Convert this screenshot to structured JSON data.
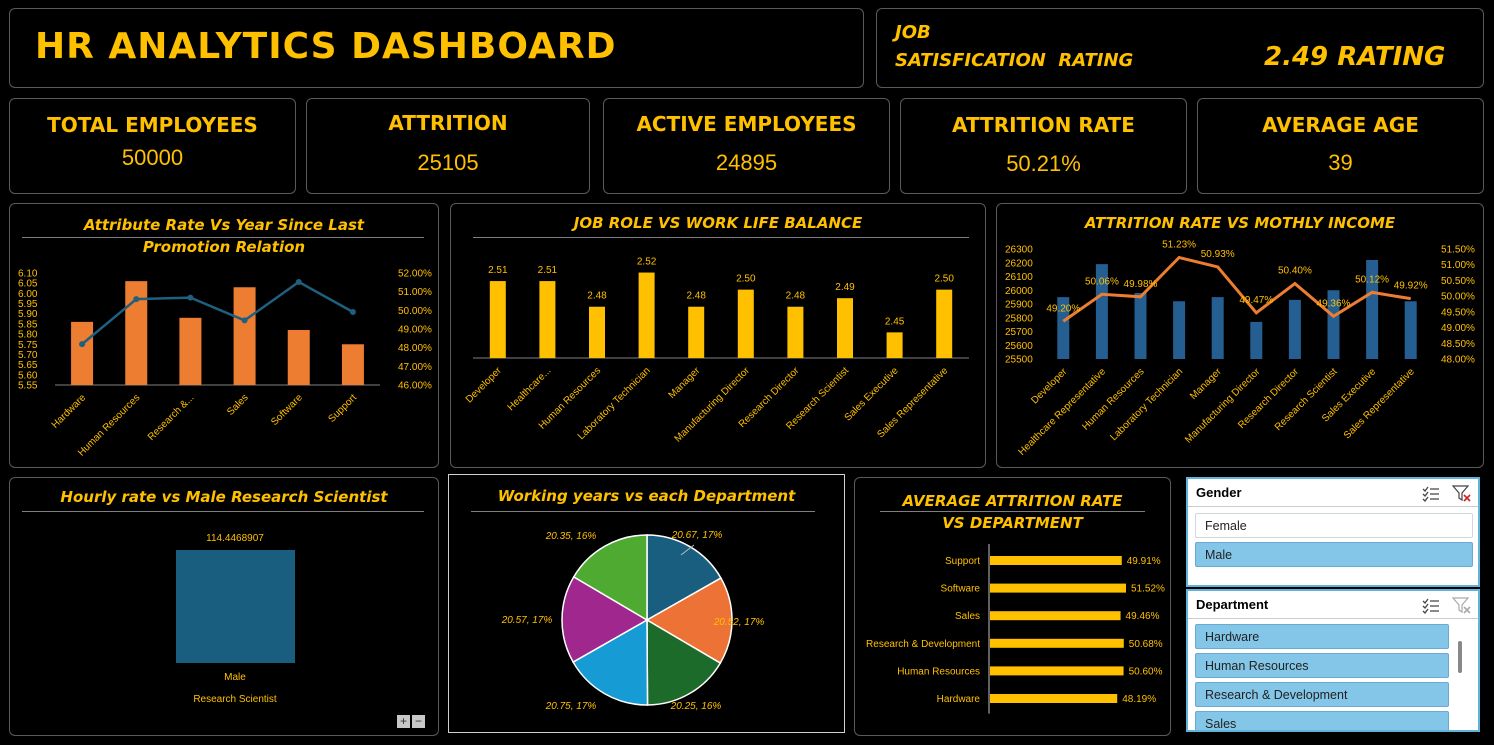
{
  "header": {
    "title": "HR ANALYTICS DASHBOARD"
  },
  "satisfaction": {
    "label_line1": "JOB",
    "label_line2": "SATISFICATION  RATING",
    "value": "2.49 RATING"
  },
  "kpis": [
    {
      "label": "TOTAL EMPLOYEES",
      "value": "50000"
    },
    {
      "label": "ATTRITION",
      "value": "25105"
    },
    {
      "label": "ACTIVE EMPLOYEES",
      "value": "24895"
    },
    {
      "label": "ATTRITION RATE",
      "value": "50.21%"
    },
    {
      "label": "AVERAGE AGE",
      "value": "39"
    }
  ],
  "colors": {
    "accent": "#FFC000",
    "bar_orange": "#ED7D31",
    "bar_blue": "#255E91",
    "line_blue": "#1F5F7F",
    "slicer_selected": "#84C6E8"
  },
  "chart_data": [
    {
      "type": "bar",
      "title": "Attribute Rate Vs Year Since Last Promotion Relation",
      "categories": [
        "Hardware",
        "Human Resources",
        "Research &...",
        "Sales",
        "Software",
        "Support"
      ],
      "series": [
        {
          "values": [
            5.86,
            6.06,
            5.88,
            6.03,
            5.82,
            5.75
          ]
        },
        {
          "values": [
            48.19,
            50.6,
            50.68,
            49.46,
            51.52,
            49.91
          ]
        }
      ],
      "ylim": [
        5.55,
        6.1
      ],
      "y_ticks": [
        "6.10",
        "6.05",
        "6.00",
        "5.95",
        "5.90",
        "5.85",
        "5.80",
        "5.75",
        "5.70",
        "5.65",
        "5.60",
        "5.55"
      ],
      "y2lim": [
        46,
        52
      ],
      "y2_ticks": [
        "52.00%",
        "51.00%",
        "50.00%",
        "49.00%",
        "48.00%",
        "47.00%",
        "46.00%"
      ]
    },
    {
      "type": "bar",
      "title": "JOB ROLE VS WORK LIFE BALANCE",
      "categories": [
        "Developer",
        "Healthcare...",
        "Human Resources",
        "Laboratory Technician",
        "Manager",
        "Manufacturing Director",
        "Research Director",
        "Research Scientist",
        "Sales Executive",
        "Sales Representative"
      ],
      "values": [
        2.51,
        2.51,
        2.48,
        2.52,
        2.48,
        2.5,
        2.48,
        2.49,
        2.45,
        2.5
      ],
      "labels": [
        "2.51",
        "2.51",
        "2.48",
        "2.52",
        "2.48",
        "2.50",
        "2.48",
        "2.49",
        "2.45",
        "2.50"
      ],
      "ylim": [
        2.42,
        2.53
      ]
    },
    {
      "type": "bar",
      "title": "ATTRITION RATE VS MOTHLY INCOME",
      "categories": [
        "Developer",
        "Healthcare Representative",
        "Human Resources",
        "Laboratory Technician",
        "Manager",
        "Manufacturing Director",
        "Research Director",
        "Research Scientist",
        "Sales Executive",
        "Sales Representative"
      ],
      "series": [
        {
          "values": [
            25950,
            26190,
            25980,
            25920,
            25950,
            25770,
            25930,
            26000,
            26220,
            25920
          ]
        },
        {
          "values": [
            49.2,
            50.06,
            49.98,
            51.23,
            50.93,
            49.47,
            50.4,
            49.36,
            50.12,
            49.92
          ]
        }
      ],
      "line_labels": [
        "49.20%",
        "50.06%",
        "49.98%",
        "51.23%",
        "50.93%",
        "49.47%",
        "50.40%",
        "49.36%",
        "50.12%",
        "49.92%"
      ],
      "ylim": [
        25500,
        26300
      ],
      "y_ticks": [
        "26300",
        "26200",
        "26100",
        "26000",
        "25900",
        "25800",
        "25700",
        "25600",
        "25500"
      ],
      "y2lim": [
        48,
        51.5
      ],
      "y2_ticks": [
        "51.50%",
        "51.00%",
        "50.50%",
        "50.00%",
        "49.50%",
        "49.00%",
        "48.50%",
        "48.00%"
      ]
    },
    {
      "type": "bar",
      "title": "Hourly rate vs Male Research Scientist",
      "categories": [
        "Male"
      ],
      "category_group": "Research Scientist",
      "values": [
        114.4468907
      ],
      "labels": [
        "114.4468907"
      ]
    },
    {
      "type": "pie",
      "title": "Working years vs each Department",
      "values": [
        20.67,
        20.52,
        20.25,
        20.75,
        20.57,
        20.35
      ],
      "labels": [
        "20.67, 17%",
        "20.52, 17%",
        "20.25, 16%",
        "20.75, 17%",
        "20.57, 17%",
        "20.35, 16%"
      ],
      "colors": [
        "#1A5E7F",
        "#ED7235",
        "#1D6B2B",
        "#169BD5",
        "#A0278E",
        "#4EAA31"
      ]
    },
    {
      "type": "bar",
      "title": "AVERAGE ATTRITION RATE VS DEPARTMENT",
      "categories": [
        "Support",
        "Software",
        "Sales",
        "Research & Development",
        "Human Resources",
        "Hardware"
      ],
      "values": [
        49.91,
        51.52,
        49.46,
        50.68,
        50.6,
        48.19
      ],
      "labels": [
        "49.91%",
        "51.52%",
        "49.46%",
        "50.68%",
        "50.60%",
        "48.19%"
      ],
      "xlim": [
        0,
        52
      ]
    }
  ],
  "slicers": {
    "gender": {
      "title": "Gender",
      "items": [
        "Female",
        "Male"
      ]
    },
    "department": {
      "title": "Department",
      "items": [
        "Hardware",
        "Human Resources",
        "Research & Development",
        "Sales"
      ]
    }
  },
  "zoom": {
    "plus": "+",
    "minus": "−"
  }
}
